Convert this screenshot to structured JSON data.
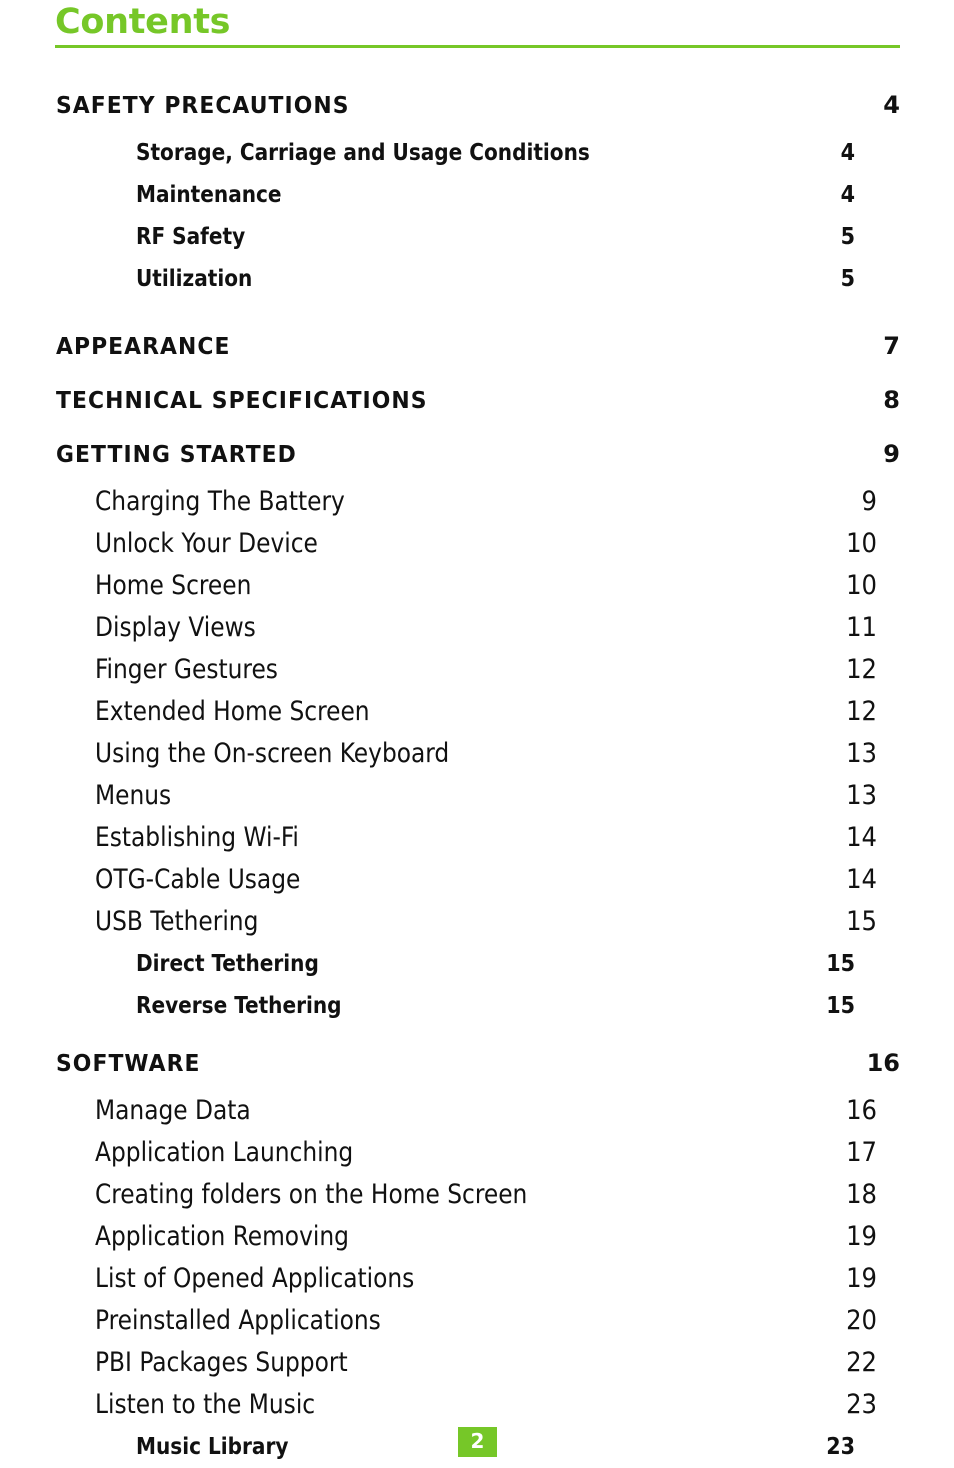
{
  "document": {
    "title": "Contents",
    "accent_color": "#76c728",
    "text_color": "#111111",
    "background_color": "#ffffff"
  },
  "footer": {
    "page_number": "2"
  },
  "toc": {
    "entries": [
      {
        "label": "SAFETY PRECAUTIONS",
        "page": "4",
        "level": 1
      },
      {
        "label": "Storage, Carriage and Usage Conditions",
        "page": "4",
        "level": "2b"
      },
      {
        "label": "Maintenance",
        "page": "4",
        "level": "2b"
      },
      {
        "label": "RF Safety",
        "page": "5",
        "level": "2b"
      },
      {
        "label": "Utilization",
        "page": "5",
        "level": "2b"
      },
      {
        "label": "APPEARANCE",
        "page": "7",
        "level": 1
      },
      {
        "label": "TECHNICAL SPECIFICATIONS",
        "page": "8",
        "level": 1
      },
      {
        "label": "GETTING STARTED",
        "page": "9",
        "level": 1
      },
      {
        "label": "Charging The Battery",
        "page": "9",
        "level": 2
      },
      {
        "label": "Unlock Your Device",
        "page": "10",
        "level": 2
      },
      {
        "label": "Home Screen",
        "page": "10",
        "level": 2
      },
      {
        "label": "Display Views",
        "page": "11",
        "level": 2
      },
      {
        "label": "Finger Gestures",
        "page": "12",
        "level": 2
      },
      {
        "label": "Extended Home Screen",
        "page": "12",
        "level": 2
      },
      {
        "label": "Using the On-screen Keyboard",
        "page": "13",
        "level": 2
      },
      {
        "label": "Menus",
        "page": "13",
        "level": 2
      },
      {
        "label": "Establishing Wi-Fi",
        "page": "14",
        "level": 2
      },
      {
        "label": "OTG-Cable Usage",
        "page": "14",
        "level": 2
      },
      {
        "label": "USB Tethering",
        "page": "15",
        "level": 2
      },
      {
        "label": "Direct Tethering",
        "page": "15",
        "level": "2b"
      },
      {
        "label": "Reverse Tethering",
        "page": "15",
        "level": "2b"
      },
      {
        "label": "SOFTWARE",
        "page": "16",
        "level": 1
      },
      {
        "label": "Manage Data",
        "page": "16",
        "level": 2
      },
      {
        "label": "Application Launching",
        "page": "17",
        "level": 2
      },
      {
        "label": "Creating folders on the Home Screen",
        "page": "18",
        "level": 2
      },
      {
        "label": "Application Removing",
        "page": "19",
        "level": 2
      },
      {
        "label": "List of Opened Applications",
        "page": "19",
        "level": 2
      },
      {
        "label": "Preinstalled Applications",
        "page": "20",
        "level": 2
      },
      {
        "label": "PBI Packages Support",
        "page": "22",
        "level": 2
      },
      {
        "label": "Listen to the Music",
        "page": "23",
        "level": 2
      },
      {
        "label": "Music Library",
        "page": "23",
        "level": "2b"
      }
    ]
  }
}
